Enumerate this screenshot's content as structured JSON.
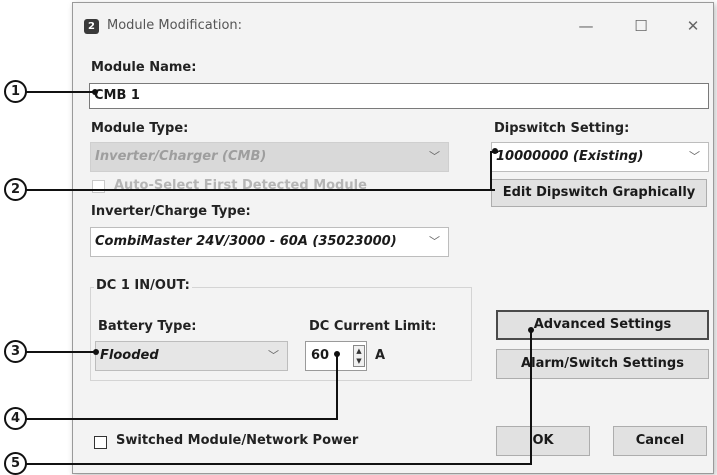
{
  "window": {
    "title": "Module Modification:",
    "app_icon_glyph": "2",
    "controls": [
      "—",
      "☐",
      "✕"
    ]
  },
  "module_name": {
    "label": "Module Name:",
    "value": "CMB 1"
  },
  "module_type": {
    "label": "Module Type:",
    "value": "Inverter/Charger (CMB)"
  },
  "auto_select": {
    "label": "Auto-Select First Detected Module"
  },
  "dipswitch": {
    "label": "Dipswitch Setting:",
    "value": "10000000 (Existing)",
    "edit_button": "Edit Dipswitch Graphically"
  },
  "inverter_type": {
    "label": "Inverter/Charge Type:",
    "value": "CombiMaster 24V/3000 - 60A  (35023000)"
  },
  "dc_group": {
    "title": "DC 1 IN/OUT:",
    "battery_type_label": "Battery Type:",
    "battery_type_value": "Flooded",
    "current_limit_label": "DC Current Limit:",
    "current_limit_value": "60",
    "current_unit": "A"
  },
  "buttons": {
    "advanced": "Advanced Settings",
    "alarm": "Alarm/Switch Settings",
    "ok": "OK",
    "cancel": "Cancel"
  },
  "switched_power": {
    "label": "Switched Module/Network Power"
  },
  "callouts": [
    "1",
    "2",
    "3",
    "4",
    "5"
  ]
}
